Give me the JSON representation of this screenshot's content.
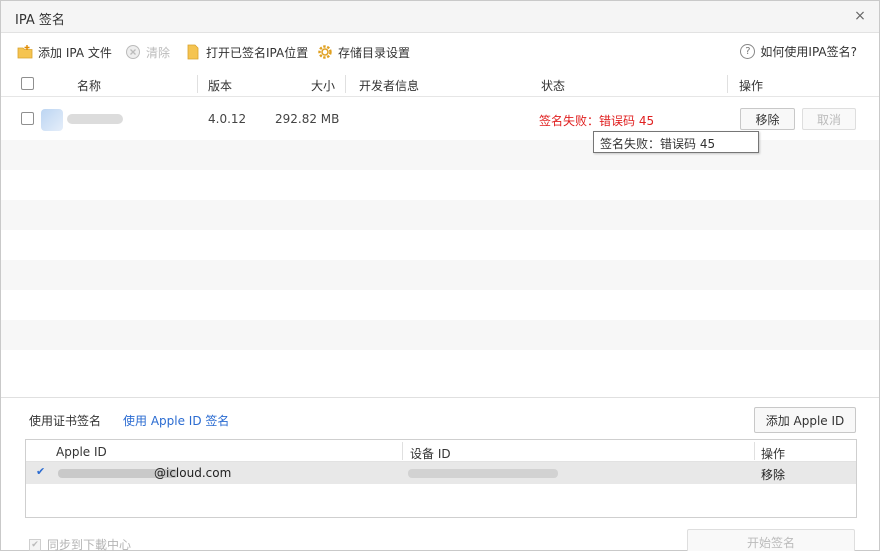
{
  "window": {
    "title": "IPA 签名",
    "close_label": "×"
  },
  "toolbar": {
    "add_ipa": "添加 IPA 文件",
    "clear": "清除",
    "open_signed": "打开已签名IPA位置",
    "storage_settings": "存储目录设置",
    "help": "如何使用IPA签名?"
  },
  "table": {
    "headers": {
      "name": "名称",
      "version": "版本",
      "size": "大小",
      "developer": "开发者信息",
      "status": "状态",
      "action": "操作"
    },
    "rows": [
      {
        "version": "4.0.12",
        "size": "292.82 MB",
        "status": "签名失败：错误码 45",
        "remove_label": "移除",
        "cancel_label": "取消"
      }
    ],
    "tooltip": "签名失败：错误码 45"
  },
  "signing": {
    "mode_cert": "使用证书签名",
    "mode_apple": "使用 Apple ID 签名",
    "add_apple_id": "添加 Apple ID",
    "accounts_header": {
      "apple_id": "Apple ID",
      "device_id": "设备 ID",
      "action": "操作"
    },
    "accounts": [
      {
        "apple_id_suffix": "@icloud.com",
        "action": "移除",
        "selected_mark": "✔"
      }
    ]
  },
  "footer": {
    "sync_label": "同步到下載中心",
    "start_sign": "开始签名"
  },
  "colors": {
    "error": "#e02020",
    "link": "#2a6bd1",
    "stripe": "#f7f7f7"
  }
}
